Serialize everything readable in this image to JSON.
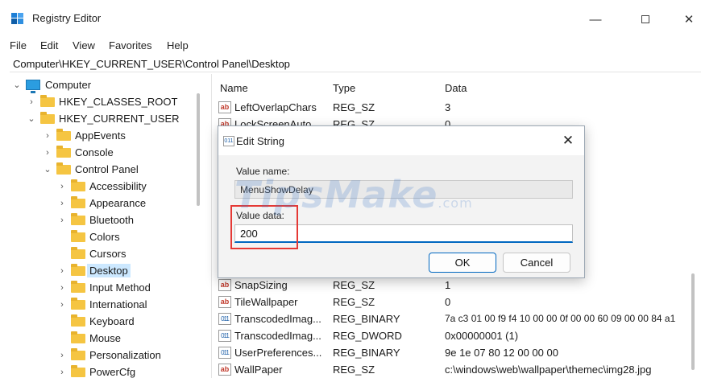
{
  "window": {
    "title": "Registry Editor",
    "min_glyph": "—",
    "close_glyph": "✕"
  },
  "menu": [
    "File",
    "Edit",
    "View",
    "Favorites",
    "Help"
  ],
  "address": "Computer\\HKEY_CURRENT_USER\\Control Panel\\Desktop",
  "tree": {
    "items": [
      {
        "label": "Computer",
        "chev": "⌄"
      },
      {
        "label": "HKEY_CLASSES_ROOT",
        "chev": "›"
      },
      {
        "label": "HKEY_CURRENT_USER",
        "chev": "⌄"
      },
      {
        "label": "AppEvents",
        "chev": "›"
      },
      {
        "label": "Console",
        "chev": "›"
      },
      {
        "label": "Control Panel",
        "chev": "⌄"
      },
      {
        "label": "Accessibility",
        "chev": "›"
      },
      {
        "label": "Appearance",
        "chev": "›"
      },
      {
        "label": "Bluetooth",
        "chev": "›"
      },
      {
        "label": "Colors",
        "chev": ""
      },
      {
        "label": "Cursors",
        "chev": ""
      },
      {
        "label": "Desktop",
        "chev": "›",
        "selected": true
      },
      {
        "label": "Input Method",
        "chev": "›"
      },
      {
        "label": "International",
        "chev": "›"
      },
      {
        "label": "Keyboard",
        "chev": ""
      },
      {
        "label": "Mouse",
        "chev": ""
      },
      {
        "label": "Personalization",
        "chev": "›"
      },
      {
        "label": "PowerCfg",
        "chev": "›"
      }
    ]
  },
  "list": {
    "headers": {
      "name": "Name",
      "type": "Type",
      "data": "Data"
    },
    "rows": [
      {
        "icon": "ab",
        "name": "LeftOverlapChars",
        "type": "REG_SZ",
        "data": "3"
      },
      {
        "icon": "ab",
        "name": "LockScreenAuto...",
        "type": "REG_SZ",
        "data": "0"
      },
      {
        "icon": "bin",
        "name": "",
        "type": "",
        "data": ""
      },
      {
        "icon": "bin",
        "name": "",
        "type": "",
        "data": ""
      },
      {
        "icon": "ab",
        "name": "",
        "type": "",
        "data": ""
      },
      {
        "icon": "bin",
        "name": "",
        "type": "",
        "data": ""
      },
      {
        "icon": "bin",
        "name": "",
        "type": "",
        "data": ""
      },
      {
        "icon": "ab",
        "name": "",
        "type": "",
        "data": ""
      },
      {
        "icon": "ab",
        "name": "",
        "type": "",
        "data": ""
      },
      {
        "icon": "ab",
        "name": "",
        "type": "",
        "data": ""
      },
      {
        "icon": "ab",
        "name": "SnapSizing",
        "type": "REG_SZ",
        "data": "1"
      },
      {
        "icon": "ab",
        "name": "TileWallpaper",
        "type": "REG_SZ",
        "data": "0"
      },
      {
        "icon": "bin",
        "name": "TranscodedImag...",
        "type": "REG_BINARY",
        "data": "7a c3 01 00 f9 f4 10 00 00 0f 00 00 60 09 00 00 84 a1"
      },
      {
        "icon": "bin",
        "name": "TranscodedImag...",
        "type": "REG_DWORD",
        "data": "0x00000001 (1)"
      },
      {
        "icon": "bin",
        "name": "UserPreferences...",
        "type": "REG_BINARY",
        "data": "9e 1e 07 80 12 00 00 00"
      },
      {
        "icon": "ab",
        "name": "WallPaper",
        "type": "REG_SZ",
        "data": "c:\\windows\\web\\wallpaper\\themec\\img28.jpg"
      }
    ]
  },
  "dialog": {
    "title": "Edit String",
    "close_glyph": "✕",
    "value_name_label": "Value name:",
    "value_name": "MenuShowDelay",
    "value_data_label": "Value data:",
    "value_data": "200",
    "ok_label": "OK",
    "cancel_label": "Cancel"
  },
  "icons": {
    "string_value": "ab",
    "binary_value": "011"
  },
  "watermark": {
    "main": "TipsMake",
    "suffix": ".com"
  }
}
